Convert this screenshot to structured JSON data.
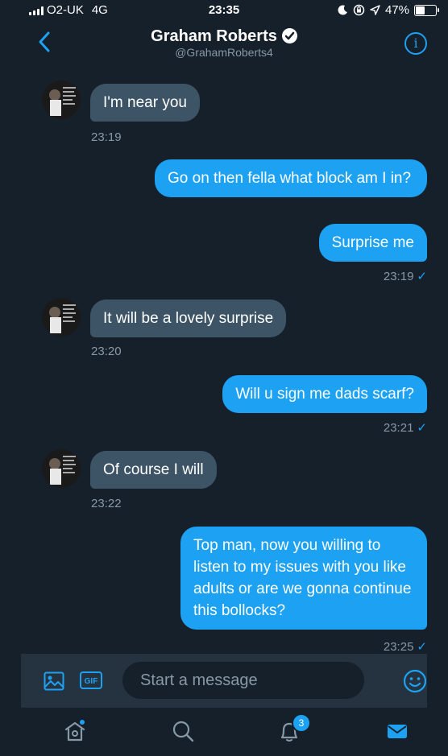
{
  "status_bar": {
    "carrier": "O2-UK",
    "network": "4G",
    "time": "23:35",
    "battery": "47%",
    "battery_level": 0.47
  },
  "header": {
    "name": "Graham Roberts",
    "handle": "@GrahamRoberts4"
  },
  "messages": [
    {
      "direction": "in",
      "text": "I'm near you",
      "time": "23:19"
    },
    {
      "direction": "out",
      "text": "Go on then fella what block am I in?"
    },
    {
      "direction": "out",
      "text": "Surprise me",
      "time": "23:19",
      "read": "✓"
    },
    {
      "direction": "in",
      "text": "It will be a lovely surprise",
      "time": "23:20"
    },
    {
      "direction": "out",
      "text": "Will u sign me dads scarf?",
      "time": "23:21",
      "read": "✓"
    },
    {
      "direction": "in",
      "text": "Of course I will",
      "time": "23:22"
    },
    {
      "direction": "out",
      "text": "Top man, now you willing to listen to my issues with you like adults or are we gonna continue this bollocks?",
      "time": "23:25",
      "read": "✓"
    }
  ],
  "composer": {
    "placeholder": "Start a message",
    "gif_label": "GIF"
  },
  "tabbar": {
    "notifications_badge": "3"
  },
  "colors": {
    "accent": "#1da1f2",
    "background": "#16202b",
    "incoming_bubble": "#3d5466"
  }
}
